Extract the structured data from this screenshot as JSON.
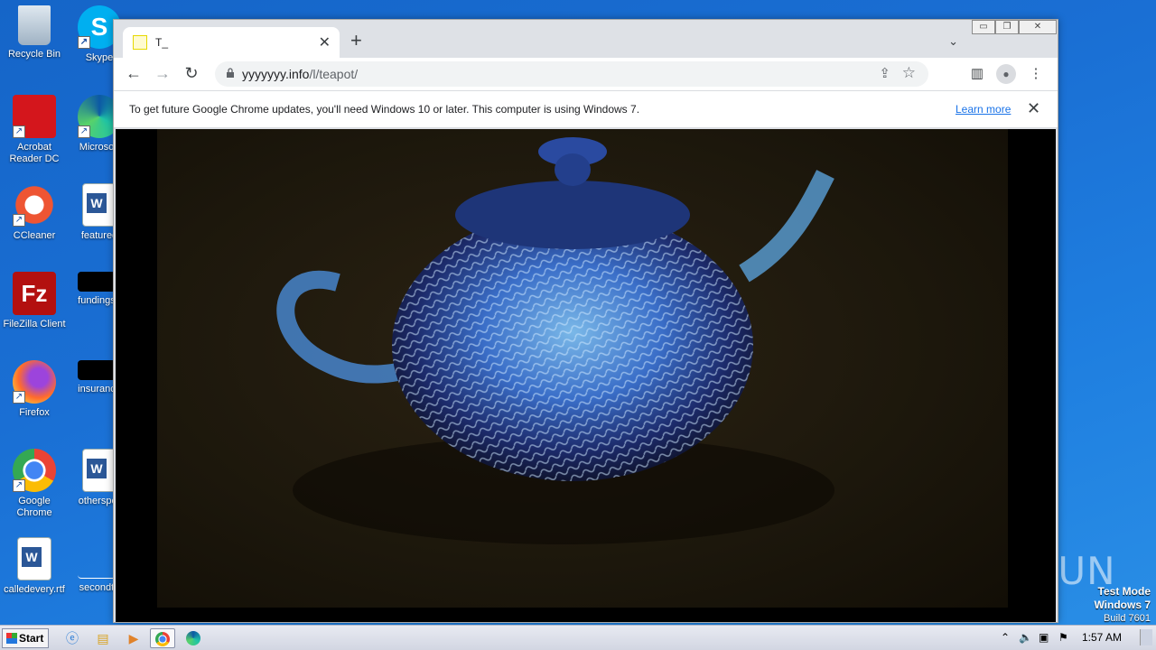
{
  "desktop": {
    "icons": [
      {
        "label": "Recycle Bin",
        "icon": "recycle-bin-icon"
      },
      {
        "label": "Skype",
        "icon": "skype-icon"
      },
      {
        "label": "Acrobat Reader DC",
        "icon": "acrobat-icon"
      },
      {
        "label": "Microsoft",
        "icon": "edge-icon"
      },
      {
        "label": "CCleaner",
        "icon": "ccleaner-icon"
      },
      {
        "label": "featured",
        "icon": "word-doc-icon"
      },
      {
        "label": "FileZilla Client",
        "icon": "filezilla-icon"
      },
      {
        "label": "fundingse",
        "icon": "file-icon"
      },
      {
        "label": "Firefox",
        "icon": "firefox-icon"
      },
      {
        "label": "insurance",
        "icon": "file-icon"
      },
      {
        "label": "Google Chrome",
        "icon": "chrome-icon"
      },
      {
        "label": "otherspor",
        "icon": "word-doc-icon"
      },
      {
        "label": "calledevery.rtf",
        "icon": "word-doc-icon"
      },
      {
        "label": "secondto",
        "icon": "file-icon"
      }
    ]
  },
  "browser": {
    "tab": {
      "title": "T_",
      "close": "✕"
    },
    "new_tab": "+",
    "tab_search": "⌄",
    "window_controls": {
      "minimize": "▭",
      "restore": "❐",
      "close": "✕"
    },
    "address": {
      "domain": "yyyyyyy.info",
      "path": "/l/teapot/"
    },
    "infobar": {
      "message": "To get future Google Chrome updates, you'll need Windows 10 or later. This computer is using Windows 7.",
      "link": "Learn more",
      "close": "✕"
    },
    "content": {
      "description_icon": "video-frame-teapot"
    }
  },
  "watermark": "ANY RUN",
  "os_badge": {
    "line1": "Test Mode",
    "line2": "Windows 7",
    "line3": "Build 7601"
  },
  "taskbar": {
    "start_label": "Start",
    "clock": "1:57 AM",
    "pinned": [
      "ie-icon",
      "explorer-icon",
      "media-player-icon",
      "chrome-icon",
      "edge-icon"
    ]
  },
  "colors": {
    "desktop": "#1a6fd4",
    "link": "#1a73e8",
    "tab_strip": "#dee1e6"
  }
}
